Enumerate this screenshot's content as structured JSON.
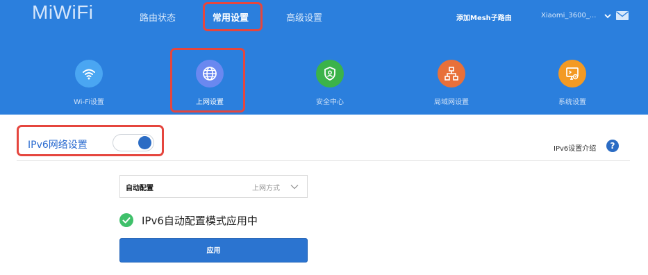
{
  "brand": {
    "logo": "MiWiFi"
  },
  "nav": {
    "tabs": [
      {
        "label": "路由状态",
        "active": false
      },
      {
        "label": "常用设置",
        "active": true
      },
      {
        "label": "高级设置",
        "active": false
      }
    ],
    "mesh_label": "添加Mesh子路由",
    "device_name": "Xiaomi_3600_...",
    "mail_icon": "mail-icon",
    "dropdown_icon": "chevron-down-icon"
  },
  "categories": [
    {
      "label": "Wi-Fi设置",
      "icon": "wifi-icon",
      "color": "#4aa6f2",
      "active": false
    },
    {
      "label": "上网设置",
      "icon": "globe-icon",
      "color": "#6a88f0",
      "active": true
    },
    {
      "label": "安全中心",
      "icon": "shield-icon",
      "color": "#3bb34a",
      "active": false
    },
    {
      "label": "局域网设置",
      "icon": "network-icon",
      "color": "#e8703a",
      "active": false
    },
    {
      "label": "系统设置",
      "icon": "system-settings-icon",
      "color": "#f39a23",
      "active": false
    }
  ],
  "section": {
    "title": "IPv6网络设置",
    "toggle_on": true,
    "intro_link": "IPv6设置介绍",
    "help_icon": "question-icon",
    "help_glyph": "?"
  },
  "form": {
    "mode_value": "自动配置",
    "mode_hint": "上网方式",
    "status_text": "IPv6自动配置模式应用中",
    "status_icon": "check-circle-icon",
    "apply_label": "应用"
  },
  "colors": {
    "header_bg": "#2b7fdd",
    "accent": "#2b6cc4",
    "success": "#3fc06a",
    "highlight": "#e5463e"
  }
}
